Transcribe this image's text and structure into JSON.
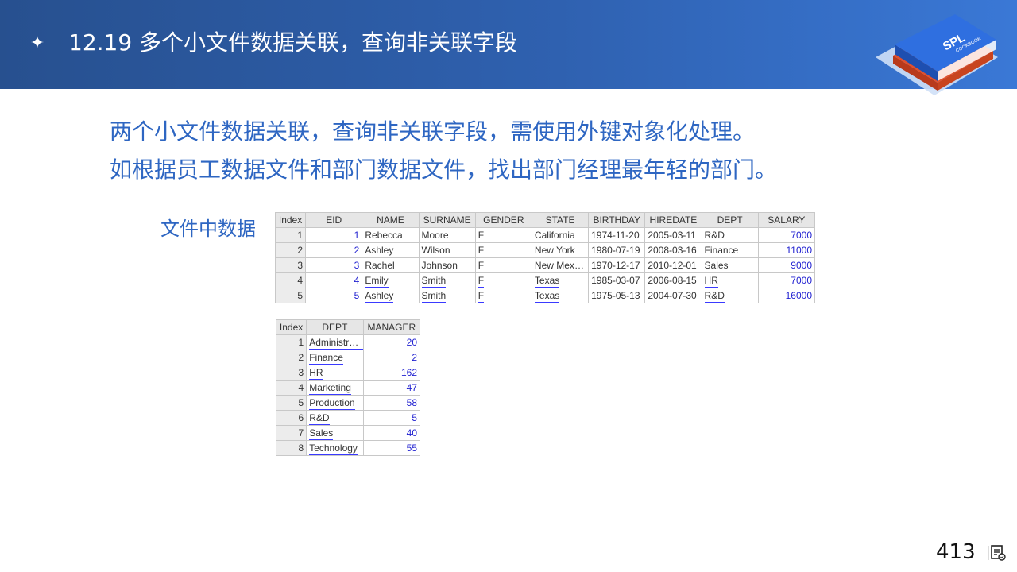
{
  "slide": {
    "bullet_icon": "four-point-star-icon",
    "title": "12.19 多个小文件数据关联，查询非关联字段",
    "logo_text": "SPL",
    "logo_subtext": "COOKBOOK"
  },
  "intro": {
    "line1": "两个小文件数据关联，查询非关联字段，需使用外键对象化处理。",
    "line2": "如根据员工数据文件和部门数据文件，找出部门经理最年轻的部门。"
  },
  "side_label": "文件中数据",
  "employee_table": {
    "columns": [
      "Index",
      "EID",
      "NAME",
      "SURNAME",
      "GENDER",
      "STATE",
      "BIRTHDAY",
      "HIREDATE",
      "DEPT",
      "SALARY"
    ],
    "rows": [
      {
        "index": "1",
        "eid": "1",
        "name": "Rebecca",
        "surname": "Moore",
        "gender": "F",
        "state": "California",
        "birthday": "1974-11-20",
        "hiredate": "2005-03-11",
        "dept": "R&D",
        "salary": "7000"
      },
      {
        "index": "2",
        "eid": "2",
        "name": "Ashley",
        "surname": "Wilson",
        "gender": "F",
        "state": "New York",
        "birthday": "1980-07-19",
        "hiredate": "2008-03-16",
        "dept": "Finance",
        "salary": "11000"
      },
      {
        "index": "3",
        "eid": "3",
        "name": "Rachel",
        "surname": "Johnson",
        "gender": "F",
        "state": "New Mexico",
        "birthday": "1970-12-17",
        "hiredate": "2010-12-01",
        "dept": "Sales",
        "salary": "9000"
      },
      {
        "index": "4",
        "eid": "4",
        "name": "Emily",
        "surname": "Smith",
        "gender": "F",
        "state": "Texas",
        "birthday": "1985-03-07",
        "hiredate": "2006-08-15",
        "dept": "HR",
        "salary": "7000"
      },
      {
        "index": "5",
        "eid": "5",
        "name": "Ashley",
        "surname": "Smith",
        "gender": "F",
        "state": "Texas",
        "birthday": "1975-05-13",
        "hiredate": "2004-07-30",
        "dept": "R&D",
        "salary": "16000"
      }
    ]
  },
  "dept_table": {
    "columns": [
      "Index",
      "DEPT",
      "MANAGER"
    ],
    "rows": [
      {
        "index": "1",
        "dept": "Administrat...",
        "manager": "20"
      },
      {
        "index": "2",
        "dept": "Finance",
        "manager": "2"
      },
      {
        "index": "3",
        "dept": "HR",
        "manager": "162"
      },
      {
        "index": "4",
        "dept": "Marketing",
        "manager": "47"
      },
      {
        "index": "5",
        "dept": "Production",
        "manager": "58"
      },
      {
        "index": "6",
        "dept": "R&D",
        "manager": "5"
      },
      {
        "index": "7",
        "dept": "Sales",
        "manager": "40"
      },
      {
        "index": "8",
        "dept": "Technology",
        "manager": "55"
      }
    ]
  },
  "footer": {
    "page_number": "413",
    "page_icon": "notes-icon"
  },
  "colors": {
    "header_start": "#27508f",
    "header_end": "#3a78d6",
    "accent_text": "#2e66c2",
    "numeric_text": "#1f1fd0",
    "link_underline": "#3a3aff"
  }
}
